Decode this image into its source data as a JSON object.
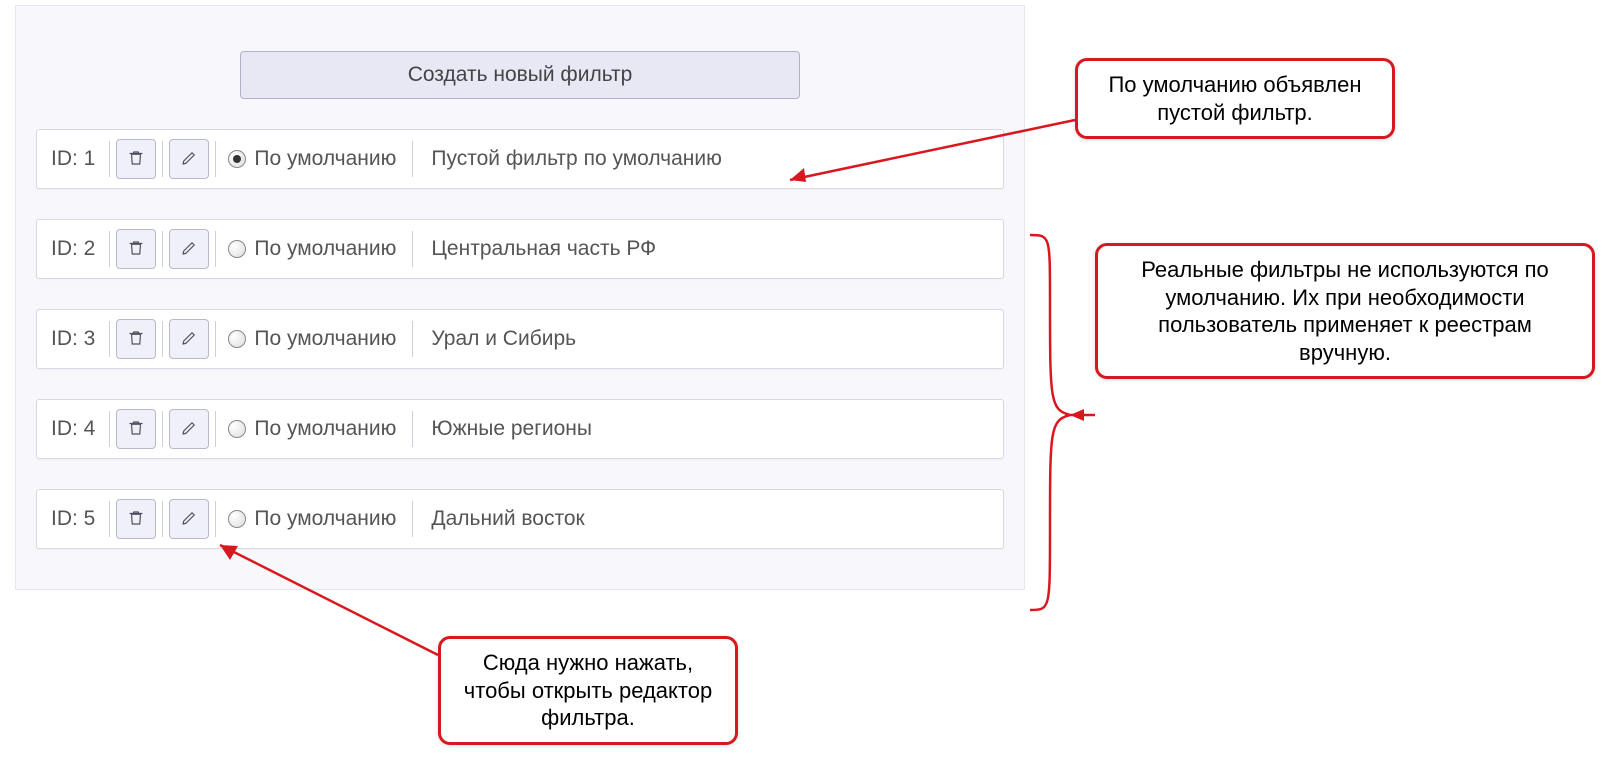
{
  "header": {
    "create_label": "Создать новый фильтр"
  },
  "row_labels": {
    "id_prefix": "ID: ",
    "default_radio": "По умолчанию"
  },
  "filters": [
    {
      "id": "1",
      "selected": true,
      "name": "Пустой фильтр по умолчанию"
    },
    {
      "id": "2",
      "selected": false,
      "name": "Центральная часть РФ"
    },
    {
      "id": "3",
      "selected": false,
      "name": "Урал и Сибирь"
    },
    {
      "id": "4",
      "selected": false,
      "name": "Южные регионы"
    },
    {
      "id": "5",
      "selected": false,
      "name": "Дальний восток"
    }
  ],
  "callouts": {
    "top_right": "По умолчанию объявлен пустой фильтр.",
    "middle_right": "Реальные фильтры не используются по умолчанию. Их при необходимости пользователь применяет к реестрам вручную.",
    "bottom": "Сюда нужно нажать, чтобы открыть редактор фильтра."
  },
  "colors": {
    "callout_border": "#d8181f",
    "button_bg": "#e8e8f5",
    "panel_bg": "#f8f8fc"
  }
}
